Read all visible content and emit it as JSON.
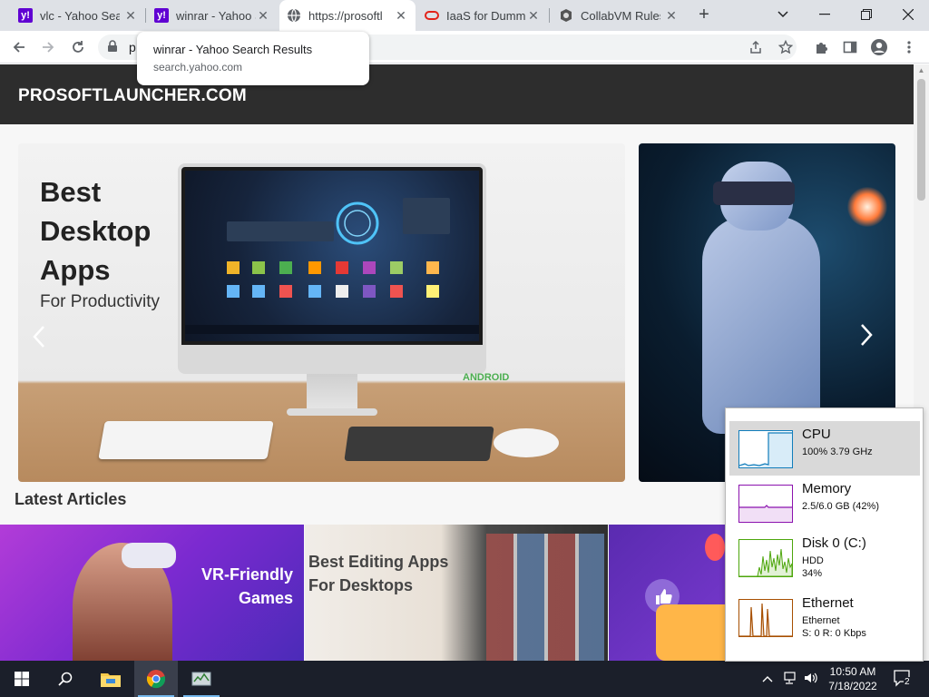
{
  "browser": {
    "tabs": [
      {
        "title": "vlc - Yahoo Sear",
        "favicon": "yahoo-icon",
        "active": false
      },
      {
        "title": "winrar - Yahoo S",
        "favicon": "yahoo-icon",
        "active": false
      },
      {
        "title": "https://prosoftl",
        "favicon": "globe-icon",
        "active": true
      },
      {
        "title": "IaaS for Dumm",
        "favicon": "oracle-icon",
        "active": false
      },
      {
        "title": "CollabVM Rules",
        "favicon": "collabvm-icon",
        "active": false
      }
    ],
    "favicon_letter": "y!",
    "new_tab_label": "+",
    "url": "p",
    "tooltip": {
      "title": "winrar - Yahoo Search Results",
      "subtitle": "search.yahoo.com"
    }
  },
  "site": {
    "logo": "PROSOFTLAUNCHER.COM",
    "hero": {
      "title": "Best Desktop Apps",
      "subtitle": "For Productivity",
      "badge": "ANDROID"
    },
    "section_title": "Latest Articles",
    "articles": [
      {
        "title": "VR-Friendly Games"
      },
      {
        "title": "Best Editing Apps For Desktops"
      },
      {
        "title": ""
      }
    ]
  },
  "perf": {
    "items": [
      {
        "name": "CPU",
        "line1": "100%  3.79 GHz",
        "line2": "",
        "color": "#117dbb",
        "selected": true
      },
      {
        "name": "Memory",
        "line1": "2.5/6.0 GB (42%)",
        "line2": "",
        "color": "#8b12ae",
        "selected": false
      },
      {
        "name": "Disk 0 (C:)",
        "line1": "HDD",
        "line2": "34%",
        "color": "#4da60c",
        "selected": false
      },
      {
        "name": "Ethernet",
        "line1": "Ethernet",
        "line2": "S: 0  R: 0 Kbps",
        "color": "#a74f01",
        "selected": false
      }
    ]
  },
  "taskbar": {
    "time": "10:50 AM",
    "date": "7/18/2022",
    "notification_count": "2"
  },
  "colors": {
    "site_header": "#2d2d2d",
    "taskbar": "#1b1f2a",
    "tab_strip": "#dee1e6"
  }
}
